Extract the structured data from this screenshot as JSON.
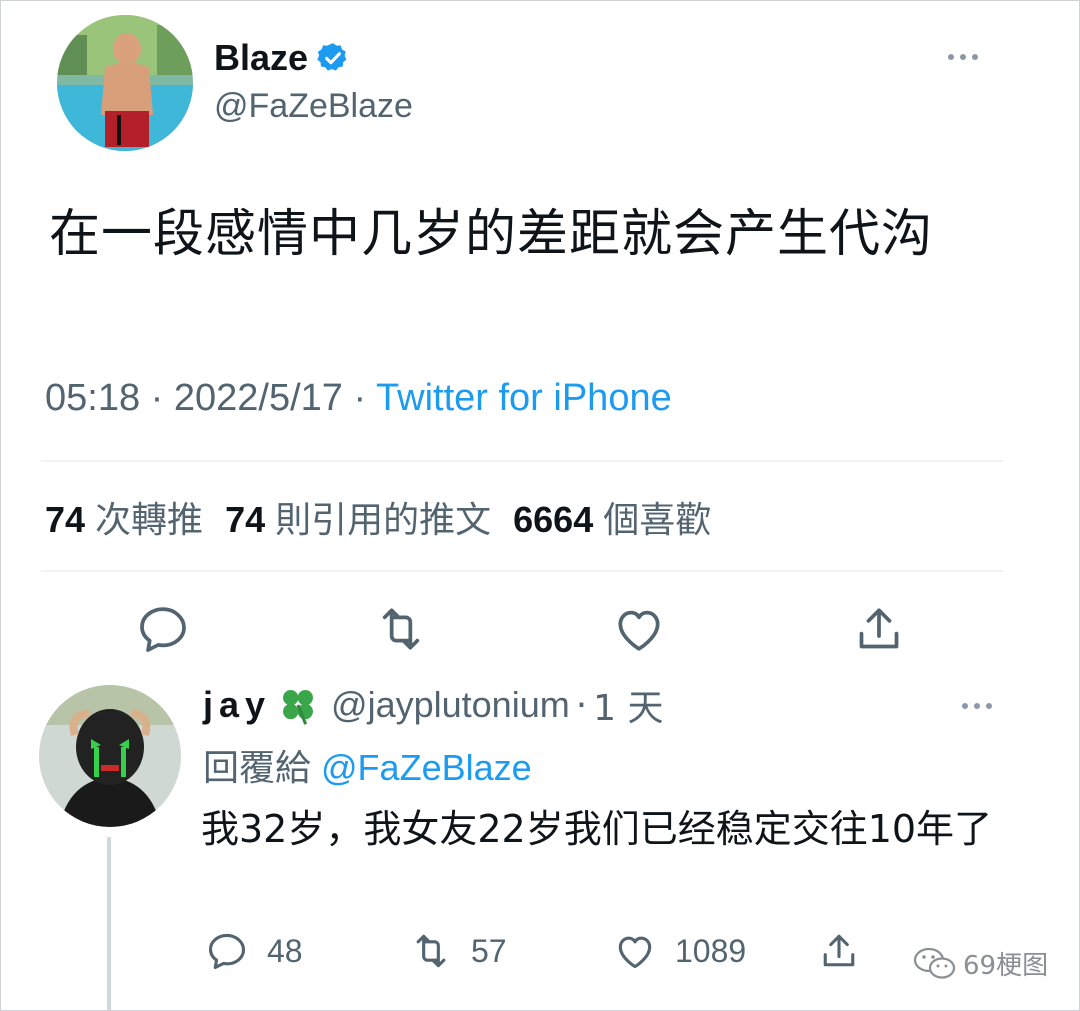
{
  "tweet": {
    "author_name": "Blaze",
    "author_handle": "@FaZeBlaze",
    "text": "在一段感情中几岁的差距就会产生代沟",
    "time": "05:18",
    "date": "2022/5/17",
    "source": "Twitter for iPhone",
    "separator": " · ",
    "stats": {
      "retweets_count": "74",
      "retweets_label": "次轉推",
      "quotes_count": "74",
      "quotes_label": "則引用的推文",
      "likes_count": "6664",
      "likes_label": "個喜歡"
    }
  },
  "reply": {
    "author_name": "jay",
    "author_handle": "@jayplutonium",
    "time_ago": "1 天",
    "replying_label": "回覆給",
    "replying_to": "@FaZeBlaze",
    "text": "我32岁，我女友22岁我们已经稳定交往10年了",
    "reply_count": "48",
    "retweet_count": "57",
    "like_count": "1089"
  },
  "watermark": "69梗图",
  "colors": {
    "text": "#0f1419",
    "secondary": "#536471",
    "accent_blue": "#1d9bf0",
    "divider": "#eff3f4"
  },
  "icons": [
    "verified-badge-icon",
    "more-icon",
    "reply-icon",
    "retweet-icon",
    "like-icon",
    "share-icon",
    "clover-icon",
    "wechat-icon"
  ]
}
